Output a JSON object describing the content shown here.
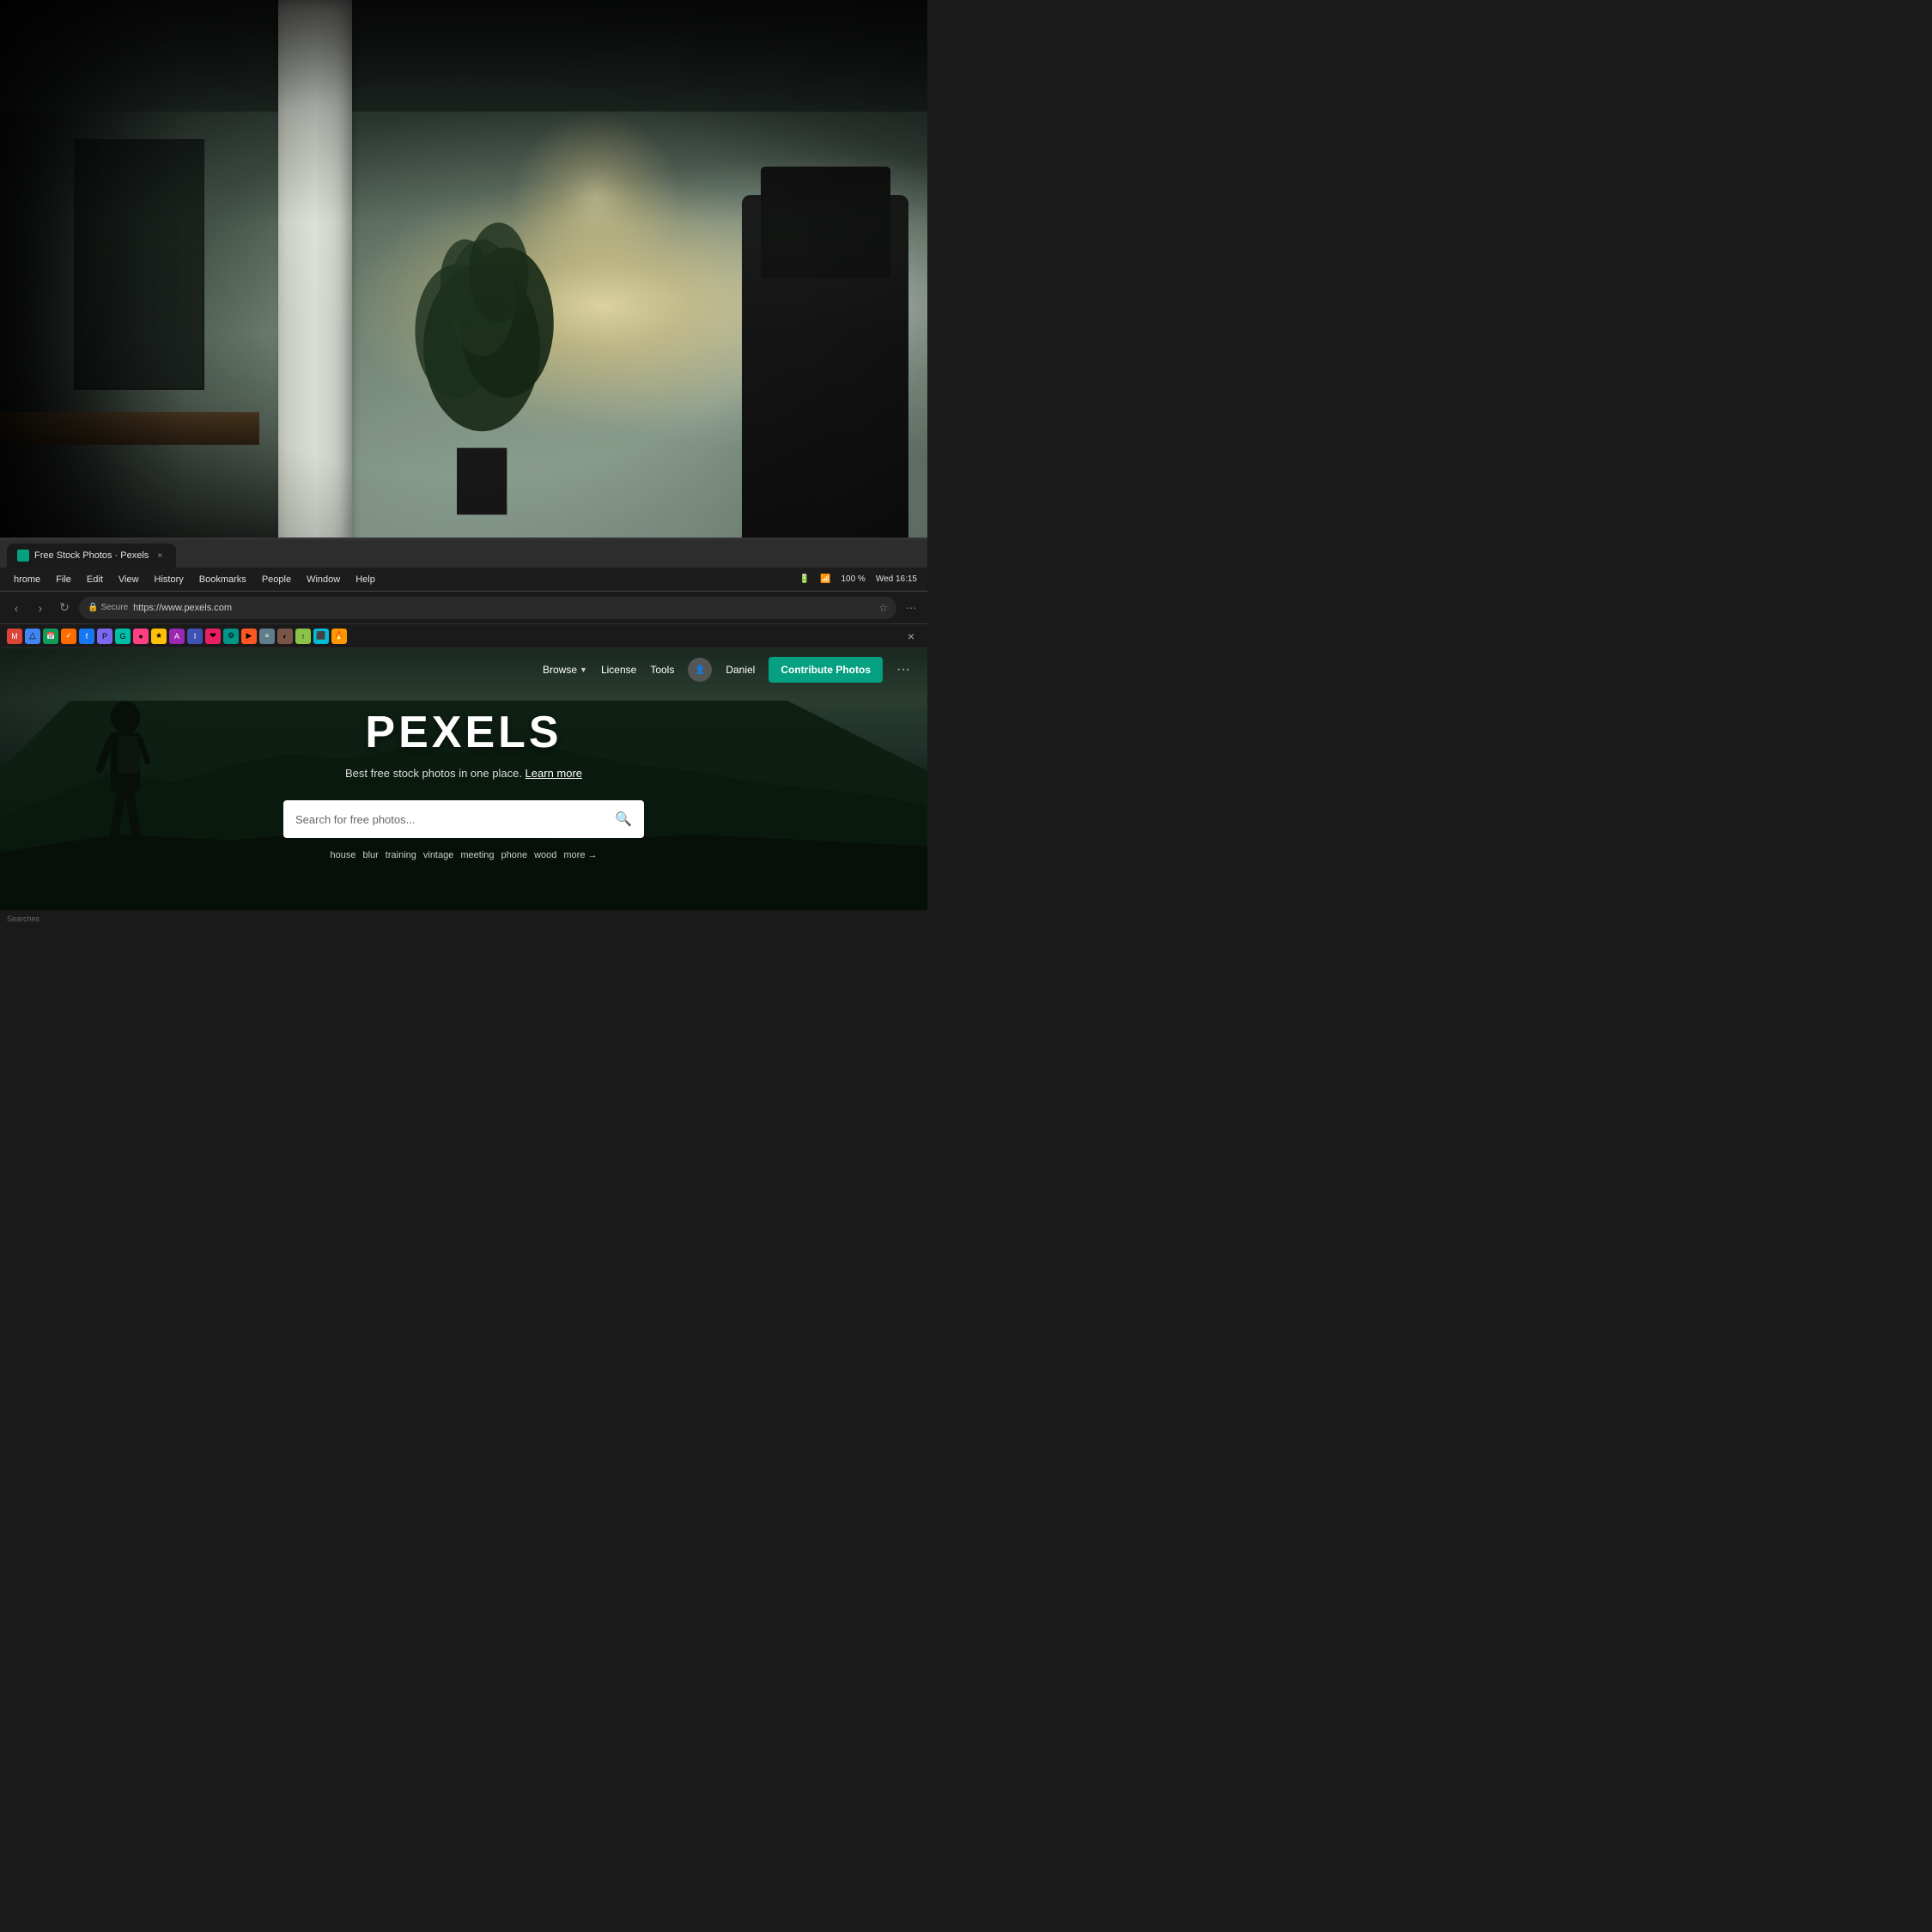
{
  "background": {
    "office_description": "Blurred office background with natural light"
  },
  "browser": {
    "tab": {
      "favicon_color": "#05a081",
      "title": "Free Stock Photos · Pexels"
    },
    "menu": {
      "app_name": "hrome",
      "items": [
        "File",
        "Edit",
        "View",
        "History",
        "Bookmarks",
        "People",
        "Window",
        "Help"
      ],
      "right_items": [
        "100 %",
        "Wed 16:15"
      ]
    },
    "address_bar": {
      "secure_text": "Secure",
      "url": "https://www.pexels.com",
      "reload_icon": "↻"
    }
  },
  "pexels": {
    "nav": {
      "browse_label": "Browse",
      "license_label": "License",
      "tools_label": "Tools",
      "user_name": "Daniel",
      "contribute_label": "Contribute Photos",
      "more_icon": "···"
    },
    "hero": {
      "title": "PEXELS",
      "subtitle": "Best free stock photos in one place.",
      "learn_more": "Learn more",
      "search_placeholder": "Search for free photos...",
      "tags": [
        "house",
        "blur",
        "training",
        "vintage",
        "meeting",
        "phone",
        "wood"
      ],
      "more_label": "more →"
    }
  },
  "status_bar": {
    "text": "Searches"
  },
  "colors": {
    "contribute_btn": "#05a081",
    "pexels_bg_dark": "#0d1810",
    "chrome_bg": "#1a1a1a"
  }
}
